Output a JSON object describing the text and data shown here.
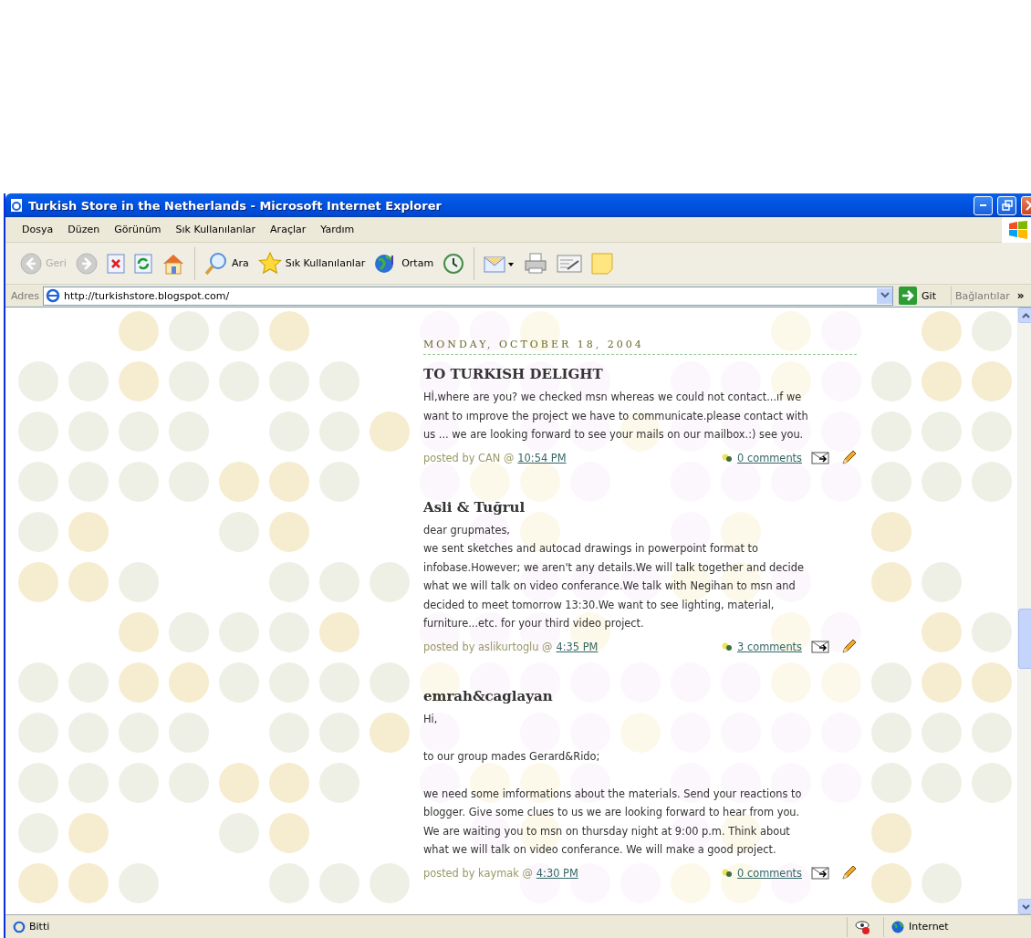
{
  "window": {
    "title": "Turkish Store in the Netherlands - Microsoft Internet Explorer"
  },
  "menu": [
    "Dosya",
    "Düzen",
    "Görünüm",
    "Sık Kullanılanlar",
    "Araçlar",
    "Yardım"
  ],
  "toolbar": [
    {
      "kind": "back",
      "label": "Geri",
      "disabled": true
    },
    {
      "kind": "forward",
      "disabled": true
    },
    {
      "kind": "stop",
      "disabled": false
    },
    {
      "kind": "refresh",
      "disabled": false
    },
    {
      "kind": "home",
      "disabled": false
    },
    {
      "kind": "search",
      "label": "Ara",
      "disabled": false
    },
    {
      "kind": "favorites",
      "label": "Sık Kullanılanlar",
      "disabled": false
    },
    {
      "kind": "media",
      "label": "Ortam",
      "disabled": false
    },
    {
      "kind": "history",
      "disabled": false
    },
    {
      "kind": "mail",
      "disabled": false
    },
    {
      "kind": "print",
      "disabled": false
    },
    {
      "kind": "edit",
      "disabled": false
    },
    {
      "kind": "note",
      "disabled": false
    }
  ],
  "address_bar": {
    "label": "Adres",
    "url": "http://turkishstore.blogspot.com/",
    "go": "Git",
    "links": "Bağlantılar",
    "more": "»"
  },
  "blog": {
    "date": "MONDAY, OCTOBER 18, 2004",
    "posts": [
      {
        "title": "TO TURKISH DELIGHT",
        "body": "Hİ,where are you? we checked msn whereas we could not contact...ıf we\nwant to ımprove the project we have to communicate.please contact with\nus ... we are looking forward to see your mails on our mailbox.:) see you.",
        "posted_by": "posted by CAN @",
        "time": "10:54 PM",
        "comments": "0 comments"
      },
      {
        "title": "Asli & Tuğrul",
        "body": "dear grupmates,\nwe sent sketches and autocad drawings in powerpoint format to\ninfobase.However; we aren't any details.We will talk together and decide\nwhat we will talk on video conferance.We talk with Negihan to msn and\ndecided to meet tomorrow 13:30.We want to see lighting, material,\nfurniture...etc. for your third video project.",
        "posted_by": "posted by aslikurtoglu @",
        "time": "4:35 PM",
        "comments": "3 comments"
      },
      {
        "title": "emrah&caglayan",
        "body": "Hi,\n\nto our group mades Gerard&Rido;\n\nwe need some imformations about the materials. Send your reactions to\nblogger. Give some clues to us we are looking forward to hear from you.\nWe are waiting you to msn on thursday night at 9:00 p.m. Think about\nwhat we will talk on video conferance. We will make a good project.",
        "posted_by": "posted by kaymak @",
        "time": "4:30 PM",
        "comments": "0 comments"
      }
    ]
  },
  "status_bar": {
    "text": "Bitti",
    "zone": "Internet"
  }
}
